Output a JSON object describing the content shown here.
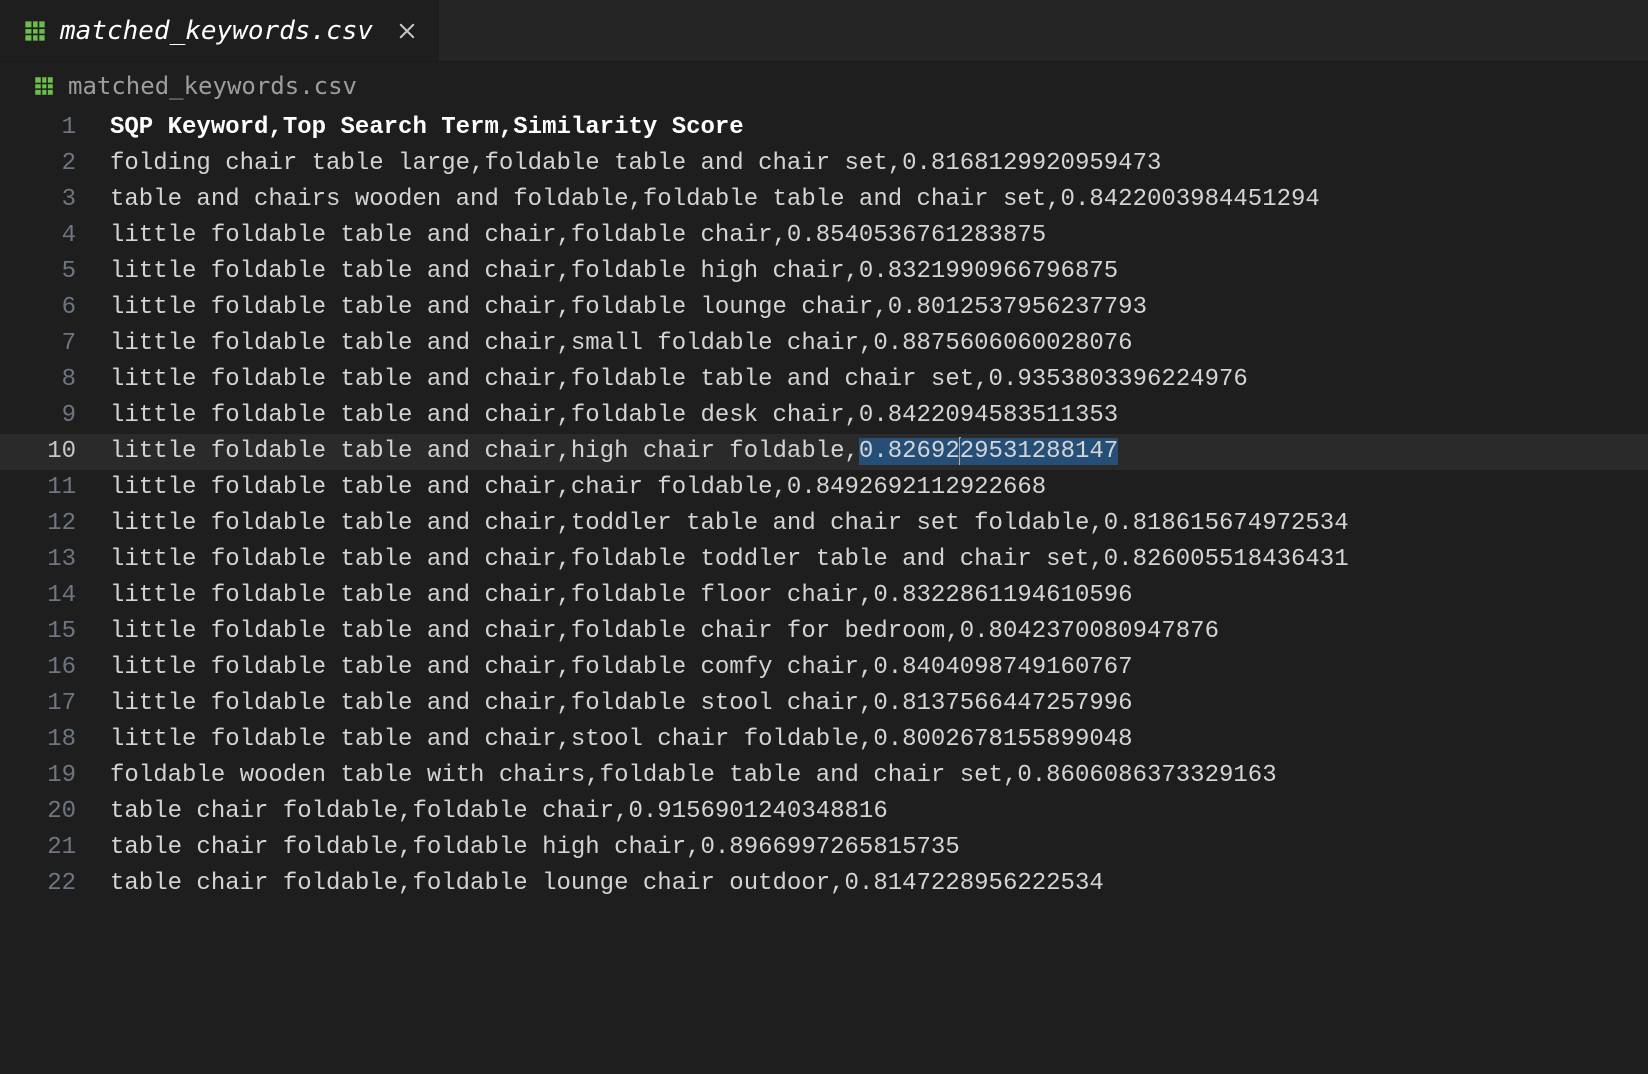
{
  "tab": {
    "filename": "matched_keywords.csv",
    "icon": "table-icon"
  },
  "breadcrumb": {
    "filename": "matched_keywords.csv",
    "icon": "table-icon"
  },
  "editor": {
    "active_line": 10,
    "lines": [
      "SQP Keyword,Top Search Term,Similarity Score",
      "folding chair table large,foldable table and chair set,0.8168129920959473",
      "table and chairs wooden and foldable,foldable table and chair set,0.8422003984451294",
      "little foldable table and chair,foldable chair,0.8540536761283875",
      "little foldable table and chair,foldable high chair,0.8321990966796875",
      "little foldable table and chair,foldable lounge chair,0.8012537956237793",
      "little foldable table and chair,small foldable chair,0.8875606060028076",
      "little foldable table and chair,foldable table and chair set,0.9353803396224976",
      "little foldable table and chair,foldable desk chair,0.8422094583511353",
      "little foldable table and chair,high chair foldable,0.8269229531288147",
      "little foldable table and chair,chair foldable,0.8492692112922668",
      "little foldable table and chair,toddler table and chair set foldable,0.818615674972534",
      "little foldable table and chair,foldable toddler table and chair set,0.826005518436431",
      "little foldable table and chair,foldable floor chair,0.8322861194610596",
      "little foldable table and chair,foldable chair for bedroom,0.8042370080947876",
      "little foldable table and chair,foldable comfy chair,0.8404098749160767",
      "little foldable table and chair,foldable stool chair,0.8137566447257996",
      "little foldable table and chair,stool chair foldable,0.8002678155899048",
      "foldable wooden table with chairs,foldable table and chair set,0.8606086373329163",
      "table chair foldable,foldable chair,0.9156901240348816",
      "table chair foldable,foldable high chair,0.8966997265815735",
      "table chair foldable,foldable lounge chair outdoor,0.8147228956222534"
    ],
    "selection": {
      "line": 10,
      "text": "0.8269229531288147",
      "cursor_offset_in_selection": 7
    }
  }
}
